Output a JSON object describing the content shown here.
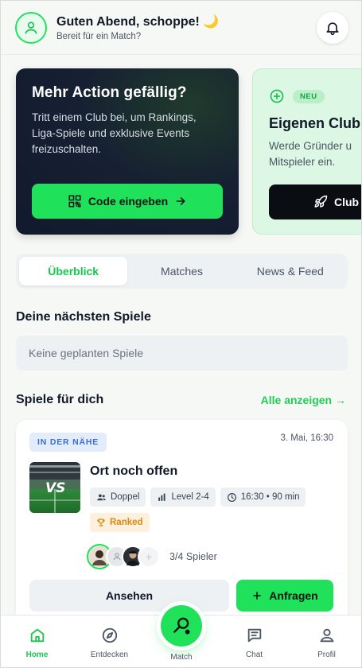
{
  "header": {
    "greeting": "Guten Abend, schoppe! 🌙",
    "subtitle": "Bereit für ein Match?"
  },
  "promo_cards": [
    {
      "title": "Mehr Action gefällig?",
      "text": "Tritt einem Club bei, um Rankings, Liga-Spiele und exklusive Events freizuschalten.",
      "button": "Code eingeben"
    },
    {
      "badge": "NEU",
      "title": "Eigenen Club",
      "text_line1": "Werde Gründer u",
      "text_line2": "Mitspieler ein.",
      "button": "Club"
    }
  ],
  "tabs": [
    {
      "label": "Überblick",
      "active": true
    },
    {
      "label": "Matches",
      "active": false
    },
    {
      "label": "News & Feed",
      "active": false
    }
  ],
  "next_games": {
    "title": "Deine nächsten Spiele",
    "empty": "Keine geplanten Spiele"
  },
  "for_you": {
    "title": "Spiele für dich",
    "see_all": "Alle anzeigen →"
  },
  "match": {
    "badge": "IN DER NÄHE",
    "date": "3. Mai, 16:30",
    "thumb_text": "VS",
    "title": "Ort noch offen",
    "chips": [
      "Doppel",
      "Level 2-4",
      "16:30 • 90 min"
    ],
    "ranked": "Ranked",
    "players": "3/4 Spieler",
    "view_button": "Ansehen",
    "request_button": "Anfragen"
  },
  "nav": {
    "items": [
      "Home",
      "Entdecken",
      "Match",
      "Chat",
      "Profil"
    ],
    "active": "Home"
  },
  "colors": {
    "accent": "#1fe25a",
    "accent_text": "#16c74e",
    "dark_card": "#162032"
  }
}
